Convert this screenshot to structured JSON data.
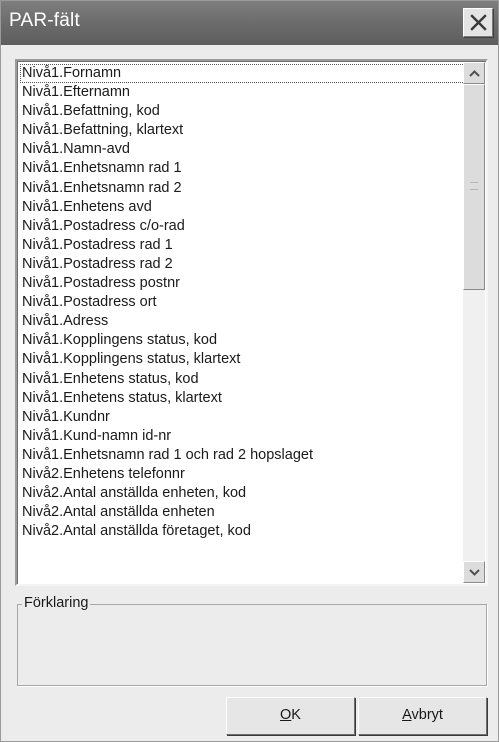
{
  "window": {
    "title": "PAR-fält"
  },
  "list": {
    "items": [
      "Nivå1.Fornamn",
      "Nivå1.Efternamn",
      "Nivå1.Befattning, kod",
      "Nivå1.Befattning, klartext",
      "Nivå1.Namn-avd",
      "Nivå1.Enhetsnamn rad 1",
      "Nivå1.Enhetsnamn rad 2",
      "Nivå1.Enhetens avd",
      "Nivå1.Postadress c/o-rad",
      "Nivå1.Postadress rad 1",
      "Nivå1.Postadress rad 2",
      "Nivå1.Postadress postnr",
      "Nivå1.Postadress ort",
      "Nivå1.Adress",
      "Nivå1.Kopplingens status, kod",
      "Nivå1.Kopplingens status, klartext",
      "Nivå1.Enhetens status, kod",
      "Nivå1.Enhetens status, klartext",
      "Nivå1.Kundnr",
      "Nivå1.Kund-namn id-nr",
      "Nivå1.Enhetsnamn rad 1 och rad 2 hopslaget",
      "Nivå2.Enhetens telefonnr",
      "Nivå2.Antal anställda enheten, kod",
      "Nivå2.Antal anställda enheten",
      "Nivå2.Antal anställda företaget, kod"
    ],
    "selected_index": 0,
    "scroll_position": 0.0
  },
  "group": {
    "legend": "Förklaring"
  },
  "buttons": {
    "ok": {
      "accel": "O",
      "rest": "K"
    },
    "cancel": {
      "accel": "A",
      "rest": "vbryt"
    }
  },
  "icons": {
    "close": "close-icon",
    "scroll_up": "chevron-up-icon",
    "scroll_down": "chevron-down-icon"
  },
  "colors": {
    "titlebar": "#6a6a6a",
    "title_text": "#ffffff",
    "dialog_bg": "#ececec"
  }
}
